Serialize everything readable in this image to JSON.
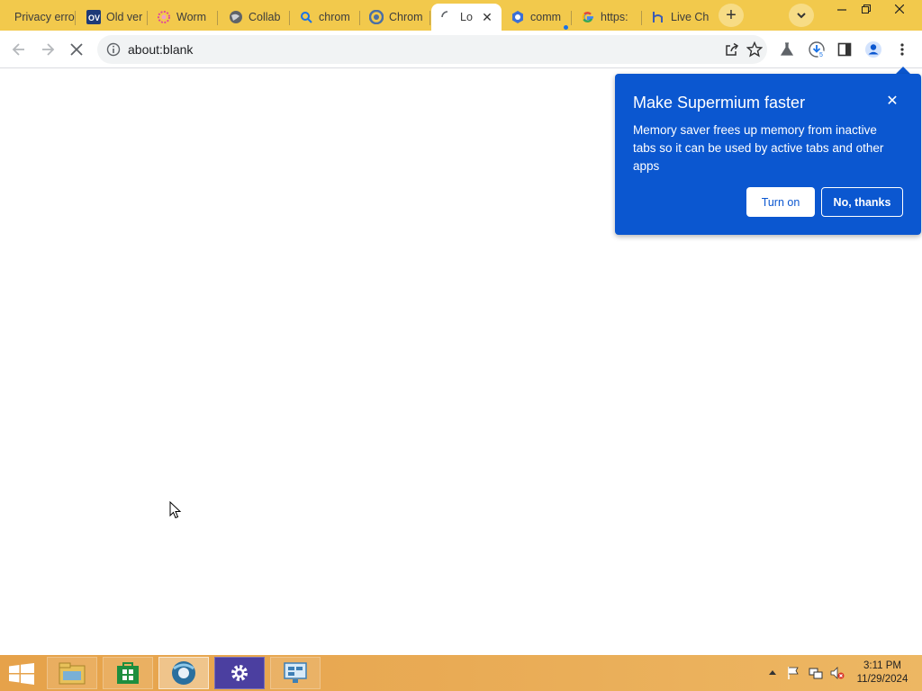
{
  "tabs": [
    {
      "title": "Privacy erro",
      "favicon": "warning-icon"
    },
    {
      "title": "Old ver",
      "favicon": "ov-icon"
    },
    {
      "title": "Worm",
      "favicon": "flower-icon"
    },
    {
      "title": "Collab",
      "favicon": "globe-icon"
    },
    {
      "title": "chrom",
      "favicon": "search-icon"
    },
    {
      "title": "Chrom",
      "favicon": "chromium-icon"
    },
    {
      "title": "Lo",
      "favicon": "loading-icon",
      "active": true
    },
    {
      "title": "comm",
      "favicon": "chrome-dev-icon"
    },
    {
      "title": "https:",
      "favicon": "google-icon"
    },
    {
      "title": "Live Ch",
      "favicon": "h-icon"
    }
  ],
  "toolbar": {
    "url": "about:blank"
  },
  "popup": {
    "title": "Make Supermium faster",
    "body": "Memory saver frees up memory from inactive tabs so it can be used by active tabs and other apps",
    "turn_on_label": "Turn on",
    "no_thanks_label": "No, thanks",
    "close_symbol": "✕"
  },
  "taskbar": {
    "time": "3:11 PM",
    "date": "11/29/2024"
  },
  "colors": {
    "tabstrip": "#f2c94c",
    "popup": "#0b57d0",
    "taskbar": "#e9ab55"
  }
}
